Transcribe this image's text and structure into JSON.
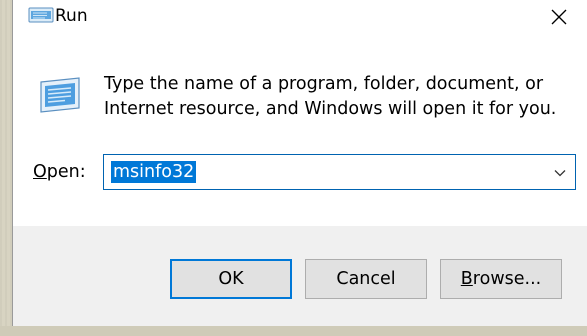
{
  "window": {
    "title": "Run",
    "close_icon": "close-icon"
  },
  "description": {
    "line1": "Type the name of a program, folder, document, or",
    "line2": "Internet resource, and Windows will open it for you."
  },
  "open_field": {
    "label_prefix": "O",
    "label_rest": "pen:",
    "value": "msinfo32",
    "dropdown_icon": "chevron-down-icon"
  },
  "buttons": {
    "ok_label": "OK",
    "cancel_label": "Cancel",
    "browse_prefix": "B",
    "browse_rest": "rowse..."
  },
  "colors": {
    "accent": "#0078d7",
    "footer_bg": "#f0f0f0",
    "button_bg": "#e1e1e1"
  }
}
